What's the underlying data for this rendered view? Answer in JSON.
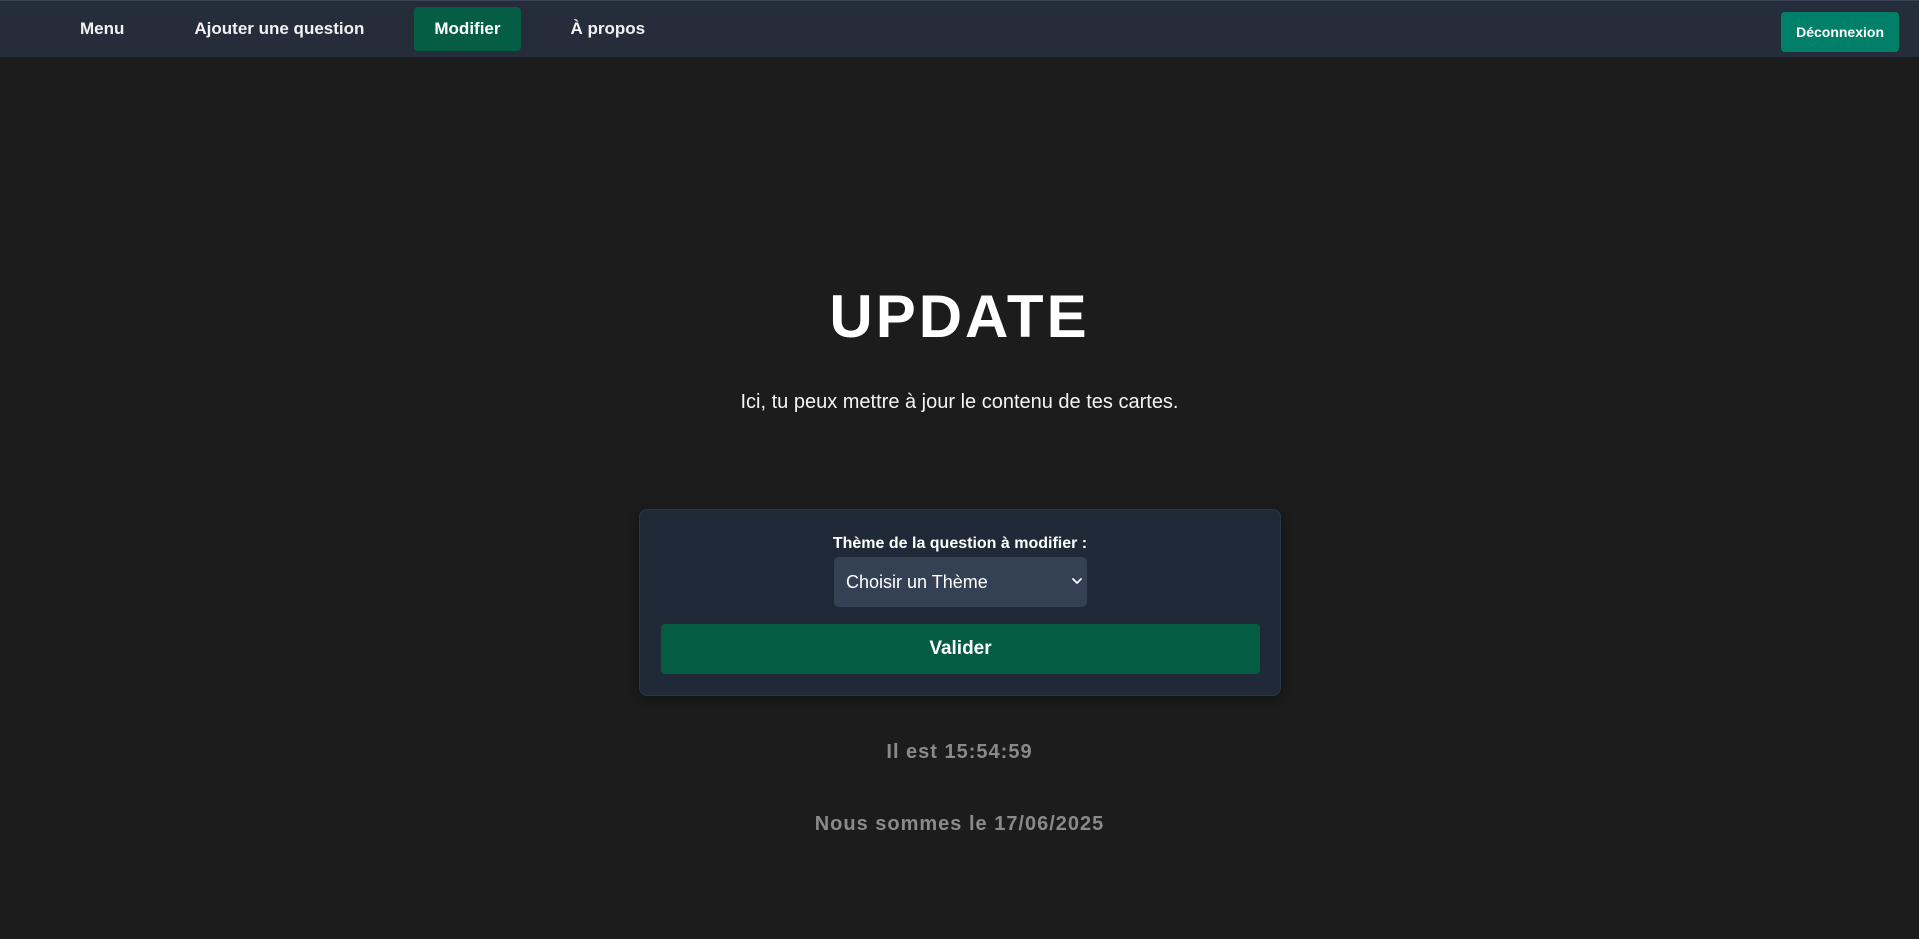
{
  "nav": {
    "items": [
      {
        "label": "Menu",
        "active": false
      },
      {
        "label": "Ajouter une question",
        "active": false
      },
      {
        "label": "Modifier",
        "active": true
      },
      {
        "label": "À propos",
        "active": false
      }
    ],
    "logout_label": "Déconnexion"
  },
  "main": {
    "title": "UPDATE",
    "subtitle": "Ici, tu peux mettre à jour le contenu de tes cartes."
  },
  "form": {
    "label": "Thème de la question à modifier :",
    "select_value": "Choisir un Thème",
    "submit_label": "Valider"
  },
  "footer": {
    "time_text": "Il est 15:54:59",
    "date_text": "Nous sommes le 17/06/2025"
  },
  "colors": {
    "background": "#1c1c1c",
    "navbar": "#252d3a",
    "active_nav": "#055e43",
    "logout": "#007f69",
    "card": "#1f2937",
    "select": "#344054",
    "submit": "#045c41",
    "muted_text": "#8a8a8a"
  },
  "icons": {
    "select_chevron": "chevron-down-icon"
  }
}
